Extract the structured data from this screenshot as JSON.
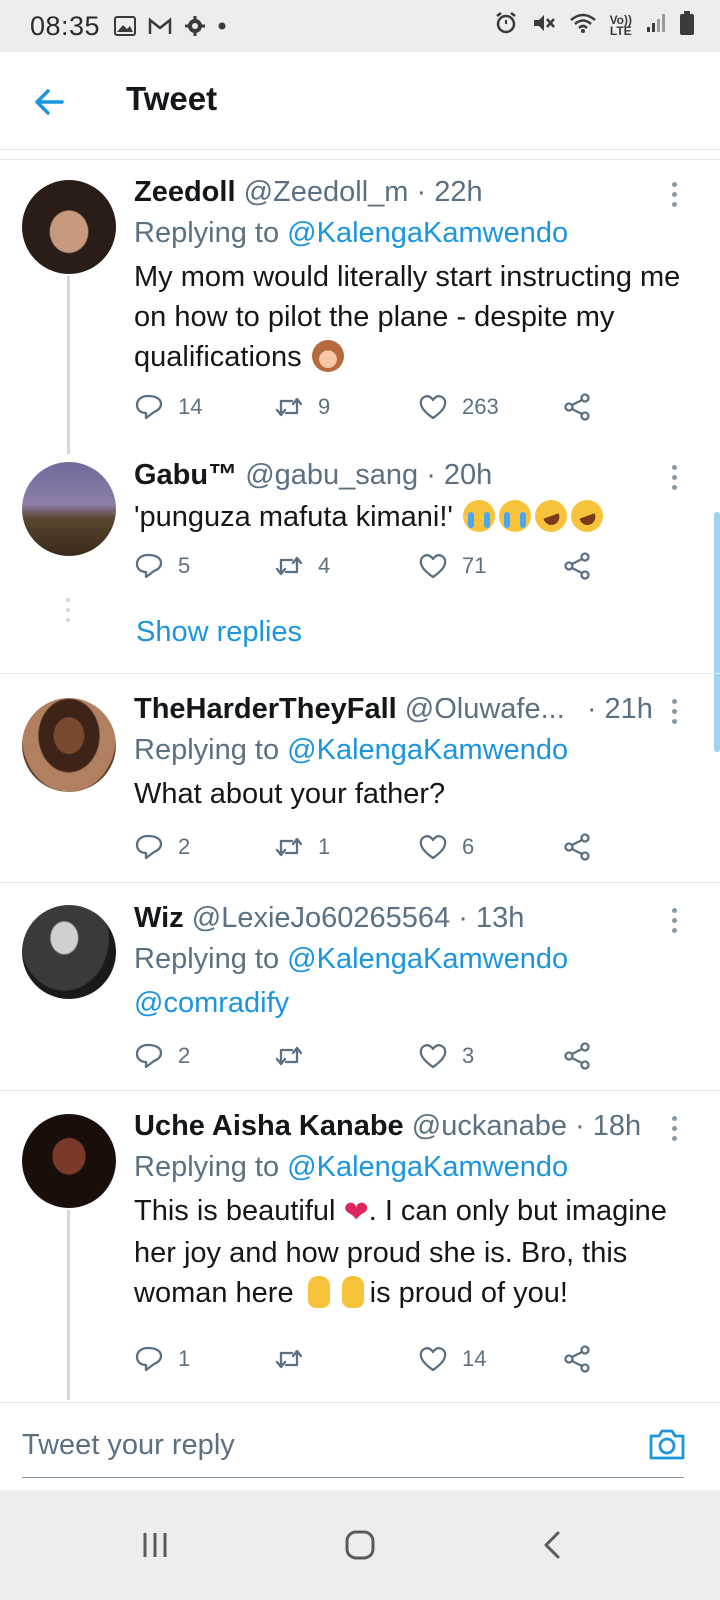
{
  "status_bar": {
    "time": "08:35",
    "left_icons": [
      "image-icon",
      "gmail-icon",
      "settings-icon",
      "dot-icon"
    ],
    "right_icons": [
      "alarm-icon",
      "mute-icon",
      "wifi-icon",
      "volte-icon",
      "signal-icon",
      "battery-icon"
    ],
    "volte_label": "Vo))\nLTE"
  },
  "header": {
    "title": "Tweet",
    "accent": "#1b95e0"
  },
  "tweets": [
    {
      "name": "Zeedoll",
      "handle": "@Zeedoll_m · 22h",
      "replying_prefix": "Replying to ",
      "replying_to": "@KalengaKamwendo",
      "text": "My mom would literally start instructing me on how to pilot the plane - despite my qualifications",
      "emoji": [
        "see-no-evil-monkey"
      ],
      "replies": "14",
      "retweets": "9",
      "likes": "263"
    },
    {
      "name": "Gabu™",
      "handle": "@gabu_sang · 20h",
      "text": "'punguza mafuta kimani!'",
      "emoji": [
        "loudly-crying-face",
        "loudly-crying-face",
        "rolling-laughing-face",
        "rolling-laughing-face"
      ],
      "replies": "5",
      "retweets": "4",
      "likes": "71",
      "show_replies": "Show replies"
    },
    {
      "name": "TheHarderTheyFall",
      "handle": "@Oluwafe...",
      "time": "· 21h",
      "replying_prefix": "Replying to ",
      "replying_to": "@KalengaKamwendo",
      "text": "What about your father?",
      "replies": "2",
      "retweets": "1",
      "likes": "6"
    },
    {
      "name": "Wiz",
      "handle": "@LexieJo60265564 · 13h",
      "replying_prefix": "Replying to ",
      "replying_to": "@KalengaKamwendo",
      "text_mention": "@comradify",
      "replies": "2",
      "retweets": "",
      "likes": "3"
    },
    {
      "name": "Uche Aisha Kanabe",
      "handle": "@uckanabe · 18h",
      "replying_prefix": "Replying to ",
      "replying_to": "@KalengaKamwendo",
      "text_part1": "This is beautiful",
      "text_part2": ". I can only but imagine her joy and how proud she is. Bro, this woman here",
      "text_part3": "is proud of you!",
      "emoji": [
        "red-heart",
        "pointing-down-hand",
        "pointing-down-hand"
      ],
      "replies": "1",
      "retweets": "",
      "likes": "14"
    }
  ],
  "composer": {
    "placeholder": "Tweet your reply"
  },
  "navbar": {
    "buttons": [
      "recents-button",
      "home-button",
      "back-button"
    ]
  }
}
